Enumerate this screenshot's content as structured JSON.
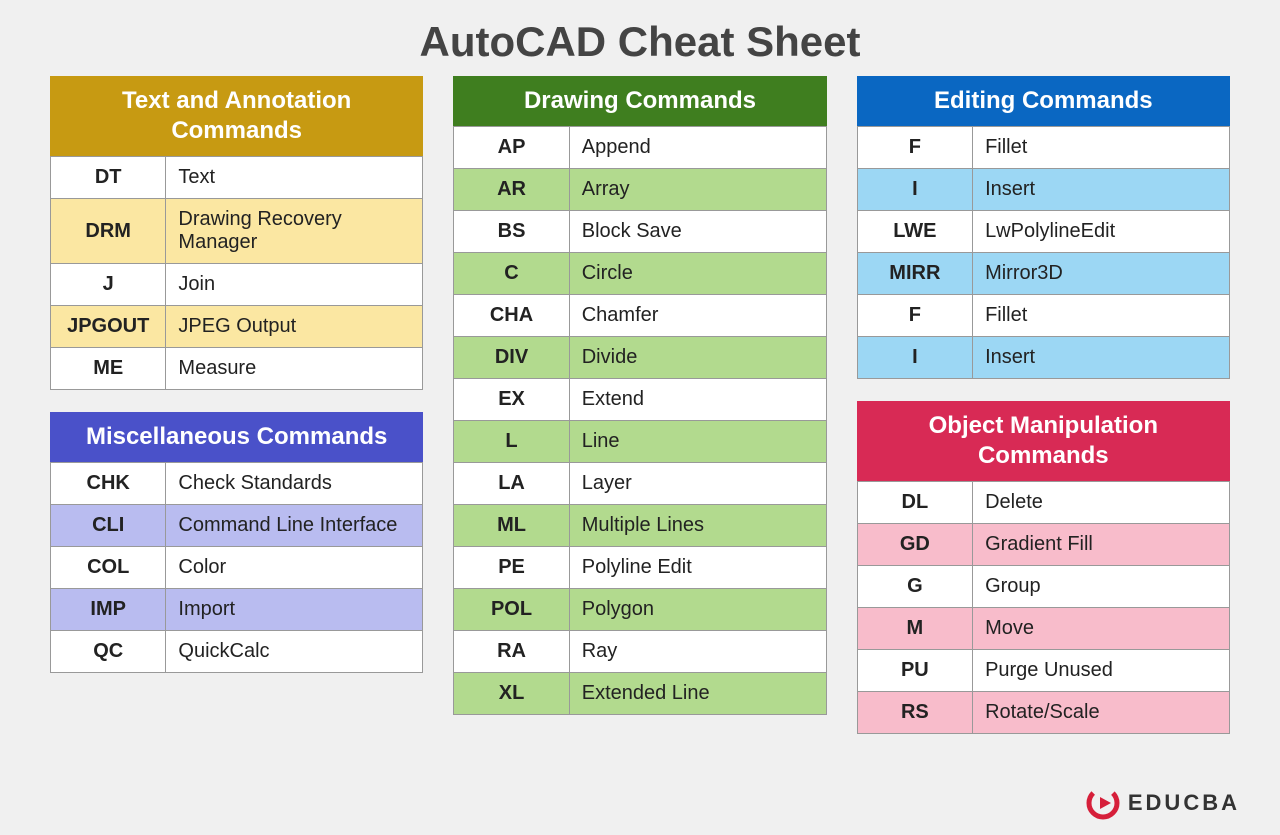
{
  "title": "AutoCAD Cheat Sheet",
  "brand": "EDUCBA",
  "sections": {
    "text_annotation": {
      "header": "Text and Annotation Commands",
      "rows": [
        {
          "cmd": "DT",
          "desc": "Text"
        },
        {
          "cmd": "DRM",
          "desc": "Drawing Recovery Manager"
        },
        {
          "cmd": "J",
          "desc": "Join"
        },
        {
          "cmd": "JPGOUT",
          "desc": "JPEG Output"
        },
        {
          "cmd": "ME",
          "desc": "Measure"
        }
      ]
    },
    "misc": {
      "header": "Miscellaneous Commands",
      "rows": [
        {
          "cmd": "CHK",
          "desc": "Check Standards"
        },
        {
          "cmd": "CLI",
          "desc": "Command Line Interface"
        },
        {
          "cmd": "COL",
          "desc": "Color"
        },
        {
          "cmd": "IMP",
          "desc": "Import"
        },
        {
          "cmd": "QC",
          "desc": "QuickCalc"
        }
      ]
    },
    "drawing": {
      "header": "Drawing Commands",
      "rows": [
        {
          "cmd": "AP",
          "desc": "Append"
        },
        {
          "cmd": "AR",
          "desc": "Array"
        },
        {
          "cmd": "BS",
          "desc": "Block Save"
        },
        {
          "cmd": "C",
          "desc": "Circle"
        },
        {
          "cmd": "CHA",
          "desc": "Chamfer"
        },
        {
          "cmd": "DIV",
          "desc": "Divide"
        },
        {
          "cmd": "EX",
          "desc": "Extend"
        },
        {
          "cmd": "L",
          "desc": "Line"
        },
        {
          "cmd": "LA",
          "desc": "Layer"
        },
        {
          "cmd": "ML",
          "desc": "Multiple Lines"
        },
        {
          "cmd": "PE",
          "desc": "Polyline Edit"
        },
        {
          "cmd": "POL",
          "desc": "Polygon"
        },
        {
          "cmd": "RA",
          "desc": "Ray"
        },
        {
          "cmd": "XL",
          "desc": "Extended Line"
        }
      ]
    },
    "editing": {
      "header": "Editing Commands",
      "rows": [
        {
          "cmd": "F",
          "desc": "Fillet"
        },
        {
          "cmd": "I",
          "desc": "Insert"
        },
        {
          "cmd": "LWE",
          "desc": "LwPolylineEdit"
        },
        {
          "cmd": "MIRR",
          "desc": "Mirror3D"
        },
        {
          "cmd": "F",
          "desc": "Fillet"
        },
        {
          "cmd": "I",
          "desc": "Insert"
        }
      ]
    },
    "object_manip": {
      "header": "Object Manipulation Commands",
      "rows": [
        {
          "cmd": "DL",
          "desc": "Delete"
        },
        {
          "cmd": "GD",
          "desc": "Gradient Fill"
        },
        {
          "cmd": "G",
          "desc": "Group"
        },
        {
          "cmd": "M",
          "desc": "Move"
        },
        {
          "cmd": "PU",
          "desc": "Purge Unused"
        },
        {
          "cmd": "RS",
          "desc": "Rotate/Scale"
        }
      ]
    }
  }
}
